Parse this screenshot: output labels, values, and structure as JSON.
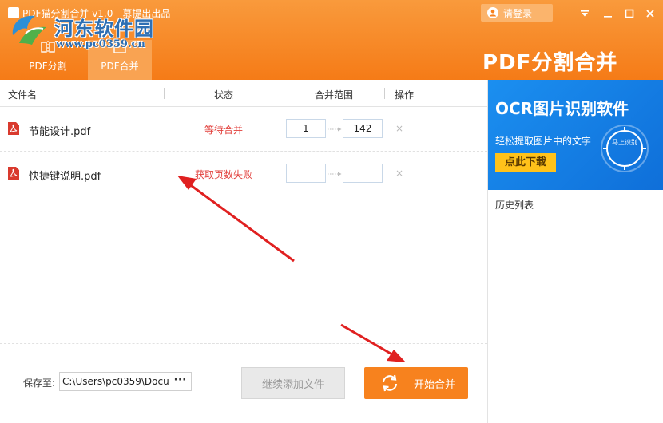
{
  "window": {
    "title": "PDF猫分割合并 v1.0 - 慕提出出品",
    "login_label": "请登录"
  },
  "watermark": {
    "name": "河东软件园",
    "url": "www.pc0359.cn"
  },
  "tabs": [
    {
      "label": "PDF分割",
      "icon": "split-icon",
      "active": false
    },
    {
      "label": "PDF合并",
      "icon": "merge-icon",
      "active": true
    }
  ],
  "brand": "PDF分割合并",
  "columns": {
    "filename": "文件名",
    "status": "状态",
    "range": "合并范围",
    "action": "操作"
  },
  "files": [
    {
      "name": "节能设计.pdf",
      "status": "等待合并",
      "range_from": "1",
      "range_to": "142",
      "delete": "×"
    },
    {
      "name": "快捷键说明.pdf",
      "status": "获取页数失败",
      "range_from": "",
      "range_to": "",
      "delete": "×"
    }
  ],
  "footer": {
    "save_label": "保存至:",
    "save_path": "C:\\Users\\pc0359\\Docu",
    "browse_label": "···",
    "add_files_label": "继续添加文件",
    "start_merge_label": "开始合并"
  },
  "side": {
    "ad_title": "OCR图片识别软件",
    "ad_subtitle": "轻松提取图片中的文字",
    "ad_button": "点此下载",
    "ad_badge": "马上识别",
    "history_label": "历史列表"
  },
  "colors": {
    "header_orange": "#f57b17",
    "status_red": "#e2403c",
    "ad_blue": "#1b8ff0",
    "ad_yellow": "#ffc21a",
    "annotation_red": "#e02020"
  }
}
